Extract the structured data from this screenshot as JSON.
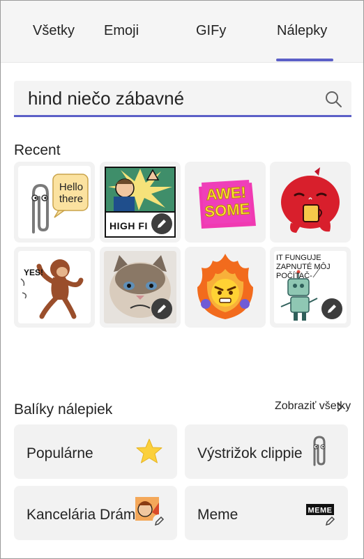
{
  "tabs": [
    {
      "label": "Všetky"
    },
    {
      "label": "Emoji"
    },
    {
      "label": "GIFy"
    },
    {
      "label": "Nálepky",
      "selected": true
    }
  ],
  "search": {
    "value": "hind niečo zábavné",
    "icon": "search-icon"
  },
  "recent": {
    "title": "Recent",
    "stickers": [
      {
        "name": "clippy-hello-there",
        "caption": "Hello there"
      },
      {
        "name": "high-five-comic",
        "caption": "HIGH FI"
      },
      {
        "name": "awesome-text",
        "caption": "AWE! SOME"
      },
      {
        "name": "red-octopus-drinking"
      },
      {
        "name": "dancing-monkey-yes",
        "caption": "YES!"
      },
      {
        "name": "grumpy-cat"
      },
      {
        "name": "angry-fire-emoji"
      },
      {
        "name": "robot-it-computer",
        "caption": "IT FUNGUJE ZAPNUTÉ MÔJ POČÍTAČ-"
      }
    ],
    "edit_icon": "pencil-icon"
  },
  "packs": {
    "title": "Balíky nálepiek",
    "see_all": "Zobraziť všetky",
    "items": [
      {
        "label": "Populárne",
        "icon": "star-icon"
      },
      {
        "label": "Výstrižok clippie",
        "icon": "paperclip-icon"
      },
      {
        "label": "Kancelária Dráma",
        "icon": "office-drama-icon"
      },
      {
        "label": "Meme",
        "icon": "meme-icon"
      }
    ]
  },
  "colors": {
    "accent": "#5b5fc7",
    "star": "#fbd03c"
  }
}
